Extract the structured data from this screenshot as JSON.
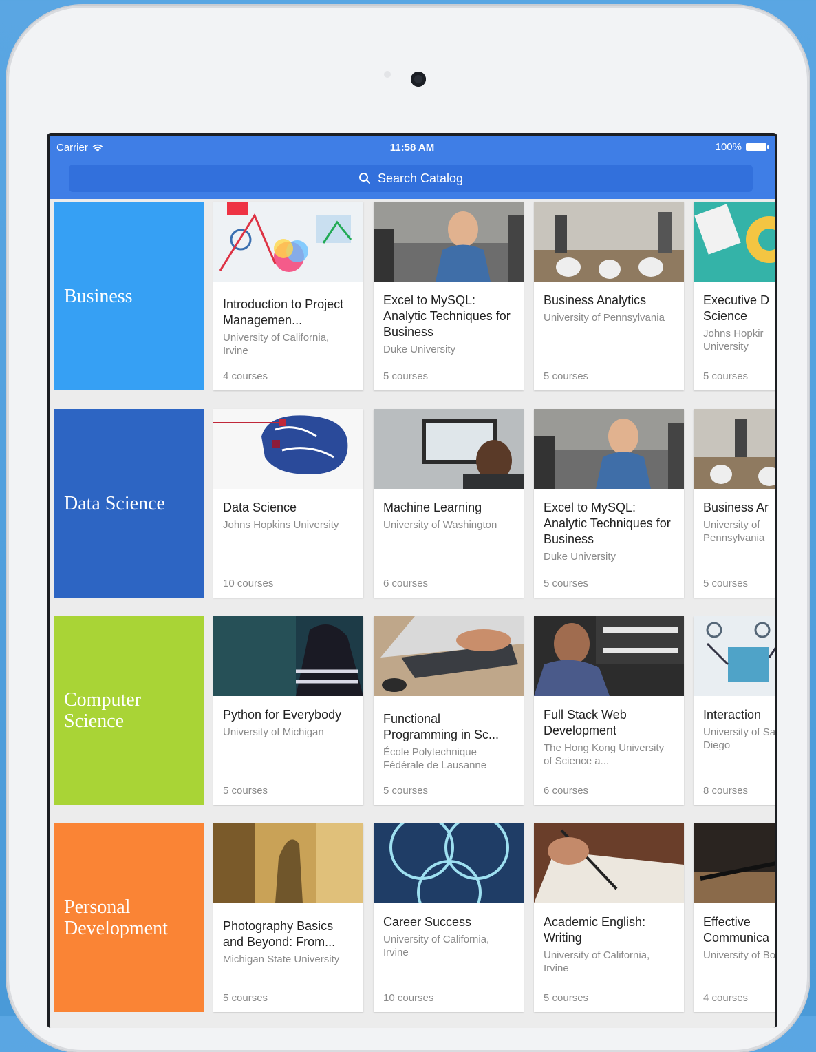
{
  "status": {
    "carrier": "Carrier",
    "time": "11:58 AM",
    "battery": "100%"
  },
  "search": {
    "placeholder": "Search Catalog"
  },
  "colors": {
    "accent": "#3f7ee6",
    "business": "#36a0f4",
    "data_science": "#2d65c3",
    "computer_science": "#a9d436",
    "personal_development": "#fa8435"
  },
  "rows": [
    {
      "category": "Business",
      "cards": [
        {
          "title": "Introduction to Project Managemen...",
          "university": "University of California, Irvine",
          "courses": "4 courses"
        },
        {
          "title": "Excel to MySQL: Analytic Techniques for Business",
          "university": "Duke University",
          "courses": "5 courses"
        },
        {
          "title": "Business Analytics",
          "university": "University of Pennsylvania",
          "courses": "5 courses"
        },
        {
          "title": "Executive D Science",
          "university": "Johns Hopkir University",
          "courses": "5 courses"
        }
      ]
    },
    {
      "category": "Data Science",
      "cards": [
        {
          "title": "Data Science",
          "university": "Johns Hopkins University",
          "courses": "10 courses"
        },
        {
          "title": "Machine Learning",
          "university": "University of Washington",
          "courses": "6 courses"
        },
        {
          "title": "Excel to MySQL: Analytic Techniques for Business",
          "university": "Duke University",
          "courses": "5 courses"
        },
        {
          "title": "Business Ar",
          "university": "University of Pennsylvania",
          "courses": "5 courses"
        }
      ]
    },
    {
      "category": "Computer Science",
      "cards": [
        {
          "title": "Python for Everybody",
          "university": "University of Michigan",
          "courses": "5 courses"
        },
        {
          "title": "Functional Programming in Sc...",
          "university": "École Polytechnique Fédérale de Lausanne",
          "courses": "5 courses"
        },
        {
          "title": "Full Stack Web Development",
          "university": "The Hong Kong University of Science a...",
          "courses": "6 courses"
        },
        {
          "title": "Interaction",
          "university": "University of San Diego",
          "courses": "8 courses"
        }
      ]
    },
    {
      "category": "Personal Development",
      "cards": [
        {
          "title": "Photography Basics and Beyond: From...",
          "university": "Michigan State University",
          "courses": "5 courses"
        },
        {
          "title": "Career Success",
          "university": "University of California, Irvine",
          "courses": "10 courses"
        },
        {
          "title": "Academic English: Writing",
          "university": "University of California, Irvine",
          "courses": "5 courses"
        },
        {
          "title": "Effective Communica",
          "university": "University of Boulder",
          "courses": "4 courses"
        }
      ]
    }
  ]
}
